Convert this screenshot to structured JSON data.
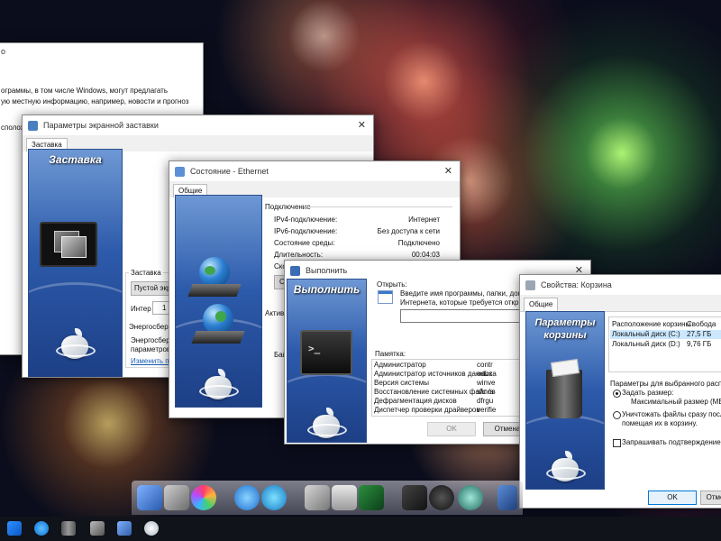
{
  "bg_window": {
    "title": "о",
    "line1": "ограммы, в том числе Windows, могут предлагать",
    "line2": "ую местную информацию, например, новости и прогноз",
    "line3": "сполож"
  },
  "screensaver": {
    "title": "Параметры экранной заставки",
    "tab": "Заставка",
    "panel_title": "Заставка",
    "group_label": "Заставка",
    "dropdown_value": "Пустой экра",
    "interval_label": "Интер",
    "interval_value": "1",
    "energy_label": "Энергосбере",
    "energy_text1": "Энергосбере",
    "energy_text2": "параметров",
    "energy_link": "Изменить па"
  },
  "ethernet": {
    "title": "Состояние - Ethernet",
    "tab": "Общие",
    "section": "Подключение",
    "rows": [
      {
        "label": "IPv4-подключение:",
        "value": "Интернет"
      },
      {
        "label": "IPv6-подключение:",
        "value": "Без доступа к сети"
      },
      {
        "label": "Состояние среды:",
        "value": "Подключено"
      },
      {
        "label": "Длительность:",
        "value": "00:04:03"
      }
    ],
    "speed_label": "Скор",
    "details_btn": "Св",
    "activity_label": "Актив",
    "bytes_label": "Бай"
  },
  "run": {
    "title": "Выполнить",
    "panel_title": "Выполнить",
    "open_label": "Открыть:",
    "desc1": "Введите имя программы, папки, доку",
    "desc2": "Интернета, которые требуется откры",
    "memo_label": "Памятка:",
    "memo": [
      {
        "name": "Администратор",
        "cmd": "contr"
      },
      {
        "name": "Администратор источников данных",
        "cmd": "odbca"
      },
      {
        "name": "Версия системы",
        "cmd": "winve"
      },
      {
        "name": "Восстановление системных файлов",
        "cmd": "sfc /s"
      },
      {
        "name": "Дефрагментация дисков",
        "cmd": "dfrgu"
      },
      {
        "name": "Диспетчер проверки драйверов",
        "cmd": "verifie"
      }
    ],
    "ok": "OK",
    "cancel": "Отмена"
  },
  "recycle": {
    "title": "Свойства: Корзина",
    "tab": "Общие",
    "panel_line1": "Параметры",
    "panel_line2": "корзины",
    "col_location": "Расположение корзины",
    "col_free": "Свобода",
    "drives": [
      {
        "name": "Локальный диск (C:)",
        "free": "27,5 ГБ"
      },
      {
        "name": "Локальный диск (D:)",
        "free": "9,76 ГБ"
      }
    ],
    "params_label": "Параметры для выбранного располо",
    "radio_size": "Задать размер:",
    "max_size_label": "Максимальный размер (МБ):",
    "radio_delete1": "Уничтожать файлы сразу после уд",
    "radio_delete2": "помещая их в корзину.",
    "confirm": "Запрашивать подтверждение на у",
    "ok": "OK",
    "cancel": "Отмена"
  }
}
